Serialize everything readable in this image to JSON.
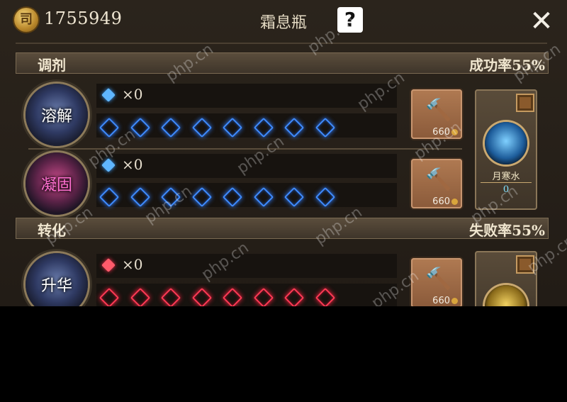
{
  "header": {
    "coin_glyph": "司",
    "currency": "1755949",
    "title": "霜息瓶",
    "help": "?",
    "close": "✕"
  },
  "sections": [
    {
      "label": "调剂",
      "rate": "成功率55%",
      "rows": [
        {
          "emblem": "溶解",
          "emblem_color": "#ffffff",
          "gem_color": "blue",
          "gem_count": "×0",
          "slots": 8,
          "cost": "660"
        },
        {
          "emblem": "凝固",
          "emblem_color": "#ff6fd0",
          "gem_color": "blue",
          "gem_count": "×0",
          "slots": 8,
          "cost": "660"
        }
      ],
      "side_item": {
        "name": "月寒水",
        "count": "0"
      }
    },
    {
      "label": "转化",
      "rate": "失败率55%",
      "rows": [
        {
          "emblem": "升华",
          "emblem_color": "#ffffff",
          "gem_color": "red",
          "gem_count": "×0",
          "slots": 8,
          "cost": "660"
        }
      ]
    }
  ],
  "watermark": "php.cn",
  "colors": {
    "blue_gem": "#3f8cff",
    "red_gem": "#ff3a55",
    "panel_bg": "#2b241c",
    "forge_btn": "#a06e48"
  }
}
